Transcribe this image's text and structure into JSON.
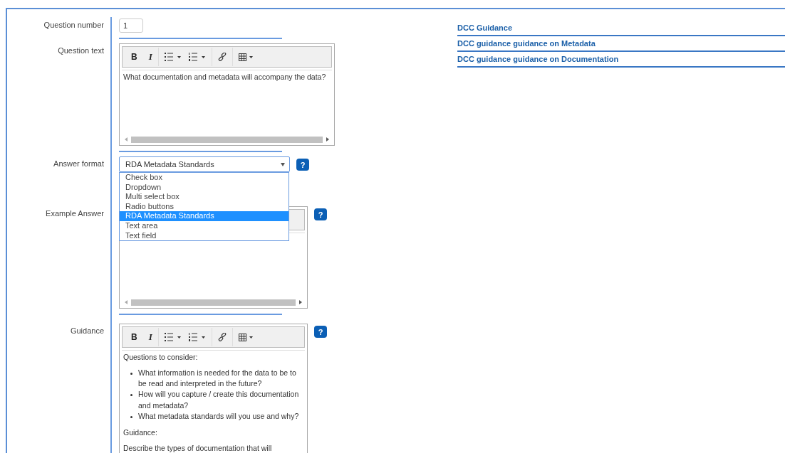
{
  "form": {
    "fields": [
      {
        "kind": "number",
        "label": "Question number",
        "value": "1",
        "rule": true
      },
      {
        "kind": "editor",
        "label": "Question text",
        "toolbar": {
          "bold": "B",
          "italic": "I",
          "visible": true
        },
        "scrollbar": true,
        "content": [
          {
            "kind": "paragraph",
            "text": "What documentation and metadata will accompany the data?"
          }
        ],
        "rule": true
      },
      {
        "kind": "select",
        "label": "Answer format",
        "value": "RDA Metadata Standards",
        "help": "?",
        "expanded": true,
        "options": [
          {
            "text": "Check box",
            "selected": false
          },
          {
            "text": "Dropdown",
            "selected": false
          },
          {
            "text": "Multi select box",
            "selected": false
          },
          {
            "text": "Radio buttons",
            "selected": false
          },
          {
            "text": "RDA Metadata Standards",
            "selected": true
          },
          {
            "text": "Text area",
            "selected": false
          },
          {
            "text": "Text field",
            "selected": false
          }
        ],
        "rule": false
      },
      {
        "kind": "editor",
        "label": "Example Answer",
        "help": "?",
        "toolbar": {
          "visible": false
        },
        "scrollbar": true,
        "rule": true
      },
      {
        "kind": "editor",
        "label": "Guidance",
        "help": "?",
        "toolbar": {
          "bold": "B",
          "italic": "I",
          "visible": true
        },
        "scrollbar": false,
        "content": [
          {
            "kind": "paragraph",
            "text": "Questions to consider:"
          },
          {
            "kind": "list",
            "items": [
              "What information is needed for the data to be to be read and interpreted in the future?",
              "How will you capture / create this documentation and metadata?",
              "What metadata standards will you use and why?"
            ]
          },
          {
            "kind": "paragraph",
            "text": "Guidance:"
          },
          {
            "kind": "paragraph",
            "text": "Describe the types of documentation that will"
          }
        ],
        "rule": false
      }
    ]
  },
  "guidance_links": [
    "DCC Guidance",
    "DCC guidance guidance on Metadata",
    "DCC guidance guidance on Documentation"
  ]
}
